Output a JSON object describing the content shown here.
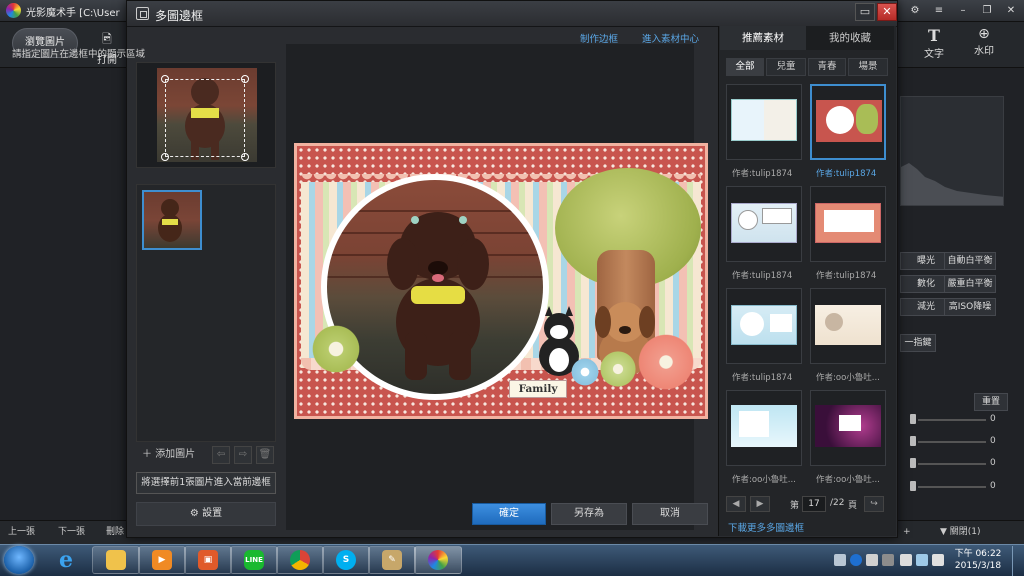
{
  "background_app": {
    "title": "光影魔术手 [C:\\User",
    "browse_label": "瀏覽圖片",
    "open_label": "打開",
    "text_tool_label": "文字",
    "watermark_tool_label": "水印",
    "right_buttons": [
      "曝光",
      "自動白平衡",
      "數化",
      "嚴重白平衡",
      "減光",
      "高ISO降噪"
    ],
    "filter_label": "一指鍵",
    "reset_label": "重置",
    "slider_values": [
      "0",
      "0",
      "0",
      "0"
    ],
    "prev_label": "上一張",
    "next_label": "下一張",
    "delete_label": "刪除",
    "close_panel_label": "▼ 關閉(1)"
  },
  "dialog": {
    "title": "多圖邊框",
    "instruction": "請指定圖片在邊框中的顯示區域",
    "link_make_frame": "制作边框",
    "link_material_center": "進入素材中心",
    "add_image_label": "添加圖片",
    "enter_frame_button": "將選擇前1張圖片進入當前邊框",
    "settings_label": "設置",
    "ok_label": "確定",
    "save_as_label": "另存為",
    "cancel_label": "取消",
    "frame_tag_text": "Family"
  },
  "template_panel": {
    "tabs": [
      "推薦素材",
      "我的收藏"
    ],
    "sub_tabs": [
      "全部",
      "兒童",
      "青春",
      "場景"
    ],
    "items": [
      {
        "author": "作者:tulip1874",
        "selected": false
      },
      {
        "author": "作者:tulip1874",
        "selected": true
      },
      {
        "author": "作者:tulip1874",
        "selected": false
      },
      {
        "author": "作者:tulip1874",
        "selected": false
      },
      {
        "author": "作者:tulip1874",
        "selected": false
      },
      {
        "author": "作者:oo小魯吐...",
        "selected": false
      },
      {
        "author": "作者:oo小魯吐...",
        "selected": false
      },
      {
        "author": "作者:oo小魯吐...",
        "selected": false
      }
    ],
    "pager": {
      "prefix": "第",
      "current": "17",
      "total": "/22",
      "suffix": "頁"
    },
    "download_more": "下載更多多圖邊框"
  },
  "taskbar": {
    "time": "下午 06:22",
    "date": "2015/3/18",
    "apps": [
      "explorer-folder",
      "media-player",
      "app-orange",
      "line",
      "chrome",
      "skype",
      "paint",
      "photo-app"
    ]
  }
}
